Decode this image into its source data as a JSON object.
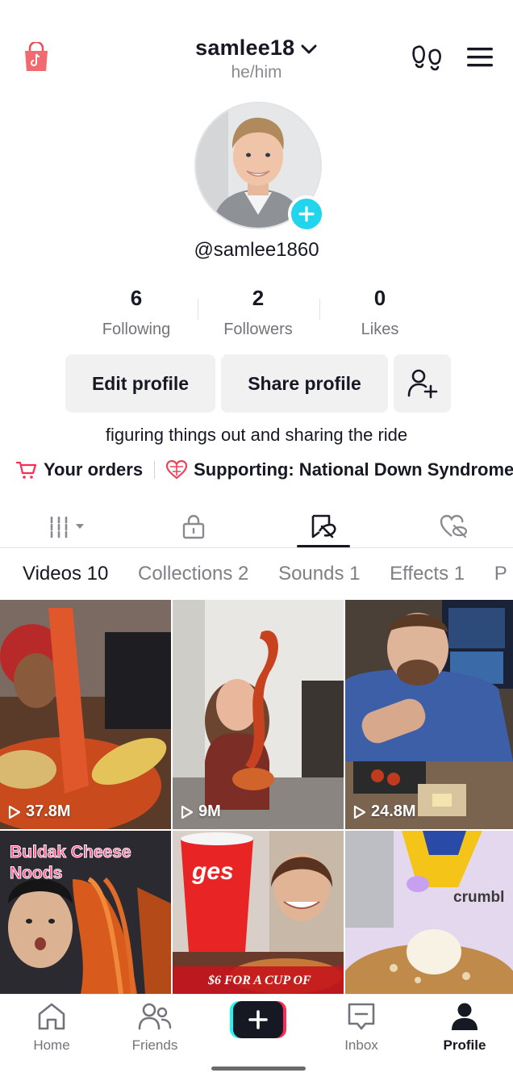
{
  "header": {
    "username": "samlee18",
    "pronouns": "he/him",
    "shop_icon": "shopping-bag-icon",
    "footprint_icon": "footprints-icon",
    "menu_icon": "hamburger-menu-icon"
  },
  "profile": {
    "handle": "@samlee1860",
    "bio": "figuring things out and sharing the ride"
  },
  "stats": [
    {
      "value": "6",
      "label": "Following"
    },
    {
      "value": "2",
      "label": "Followers"
    },
    {
      "value": "0",
      "label": "Likes"
    }
  ],
  "actions": {
    "edit_label": "Edit profile",
    "share_label": "Share profile",
    "add_friend_icon": "add-friend-icon"
  },
  "links": {
    "orders": "Your orders",
    "supporting": "Supporting: National Down Syndrome"
  },
  "content_tabs": [
    {
      "icon": "grid-icon",
      "active": false
    },
    {
      "icon": "lock-icon",
      "active": false
    },
    {
      "icon": "favorites-icon",
      "active": true
    },
    {
      "icon": "liked-hidden-icon",
      "active": false
    }
  ],
  "filters": [
    {
      "label": "Videos 10",
      "active": true
    },
    {
      "label": "Collections 2",
      "active": false
    },
    {
      "label": "Sounds 1",
      "active": false
    },
    {
      "label": "Effects 1",
      "active": false
    },
    {
      "label": "P",
      "active": false
    }
  ],
  "videos": [
    {
      "views": "37.8M"
    },
    {
      "views": "9M"
    },
    {
      "views": "24.8M"
    },
    {
      "views": "",
      "overlay": "Buldak Cheese Noods"
    },
    {
      "views": "",
      "overlay": "$6 FOR A CUP OF",
      "brand": "ges"
    },
    {
      "views": "",
      "overlay": "crumbl"
    }
  ],
  "bottom_nav": [
    {
      "label": "Home",
      "icon": "home-icon"
    },
    {
      "label": "Friends",
      "icon": "friends-icon"
    },
    {
      "label": "",
      "icon": "create-plus-icon"
    },
    {
      "label": "Inbox",
      "icon": "inbox-icon"
    },
    {
      "label": "Profile",
      "icon": "profile-icon",
      "active": true
    }
  ],
  "colors": {
    "accent_cyan": "#20d5ec",
    "accent_red": "#fe2c55",
    "text": "#161823",
    "muted": "#73747b"
  }
}
